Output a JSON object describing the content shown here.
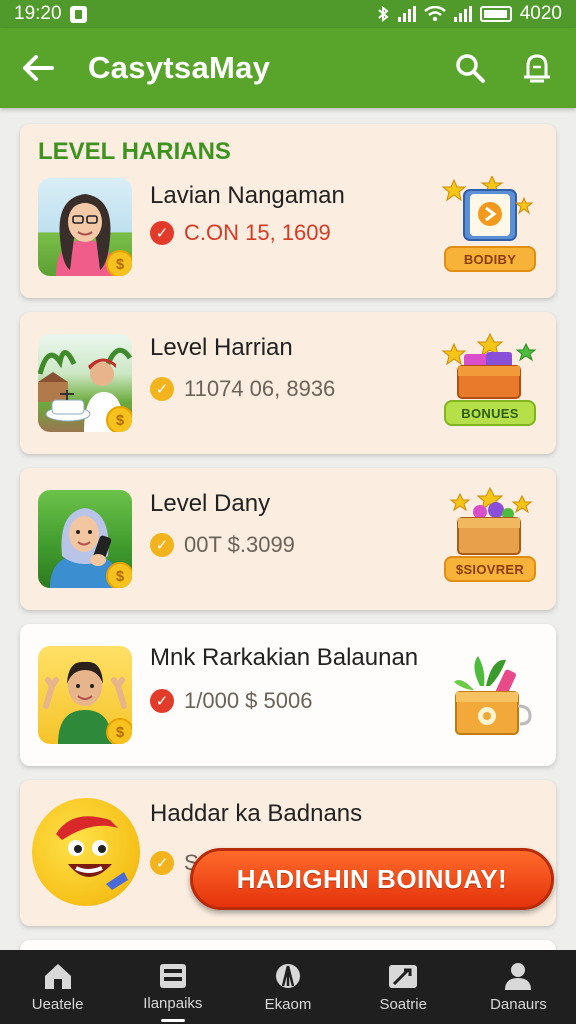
{
  "status_bar": {
    "time": "19:20",
    "battery_text": "4020"
  },
  "app_bar": {
    "title": "CasytsaMay"
  },
  "section": {
    "title": "LEVEL HARIANS"
  },
  "cards": [
    {
      "name": "Lavian Nangaman",
      "amount": "C.ON 15, 1609",
      "status": "red",
      "reward_label": "BODIBY"
    },
    {
      "name": "Level Harrian",
      "amount": "11074 06, 8936",
      "status": "gold",
      "reward_label": "BONUES"
    },
    {
      "name": "Level Dany",
      "amount": "00T $.3099",
      "status": "gold",
      "reward_label": "$SIOVRER"
    },
    {
      "name": "Mnk Rarkakian Balaunan",
      "amount": "1/000 $ 5006",
      "status": "red",
      "reward_label": ""
    },
    {
      "name": "Haddar ka Badnans",
      "amount": "S",
      "status": "gold",
      "reward_label": ""
    }
  ],
  "fab": {
    "label": "HADIGHIN BOINUAY!"
  },
  "bottom_nav": [
    {
      "label": "Ueatele",
      "icon": "home-icon"
    },
    {
      "label": "Ilanpaiks",
      "icon": "grid-icon"
    },
    {
      "label": "Ekaom",
      "icon": "wallet-icon"
    },
    {
      "label": "Soatrie",
      "icon": "tools-icon"
    },
    {
      "label": "Danaurs",
      "icon": "profile-icon"
    }
  ],
  "colors": {
    "primary": "#59a52c",
    "accent": "#e5330c",
    "section_title": "#3e9320"
  }
}
